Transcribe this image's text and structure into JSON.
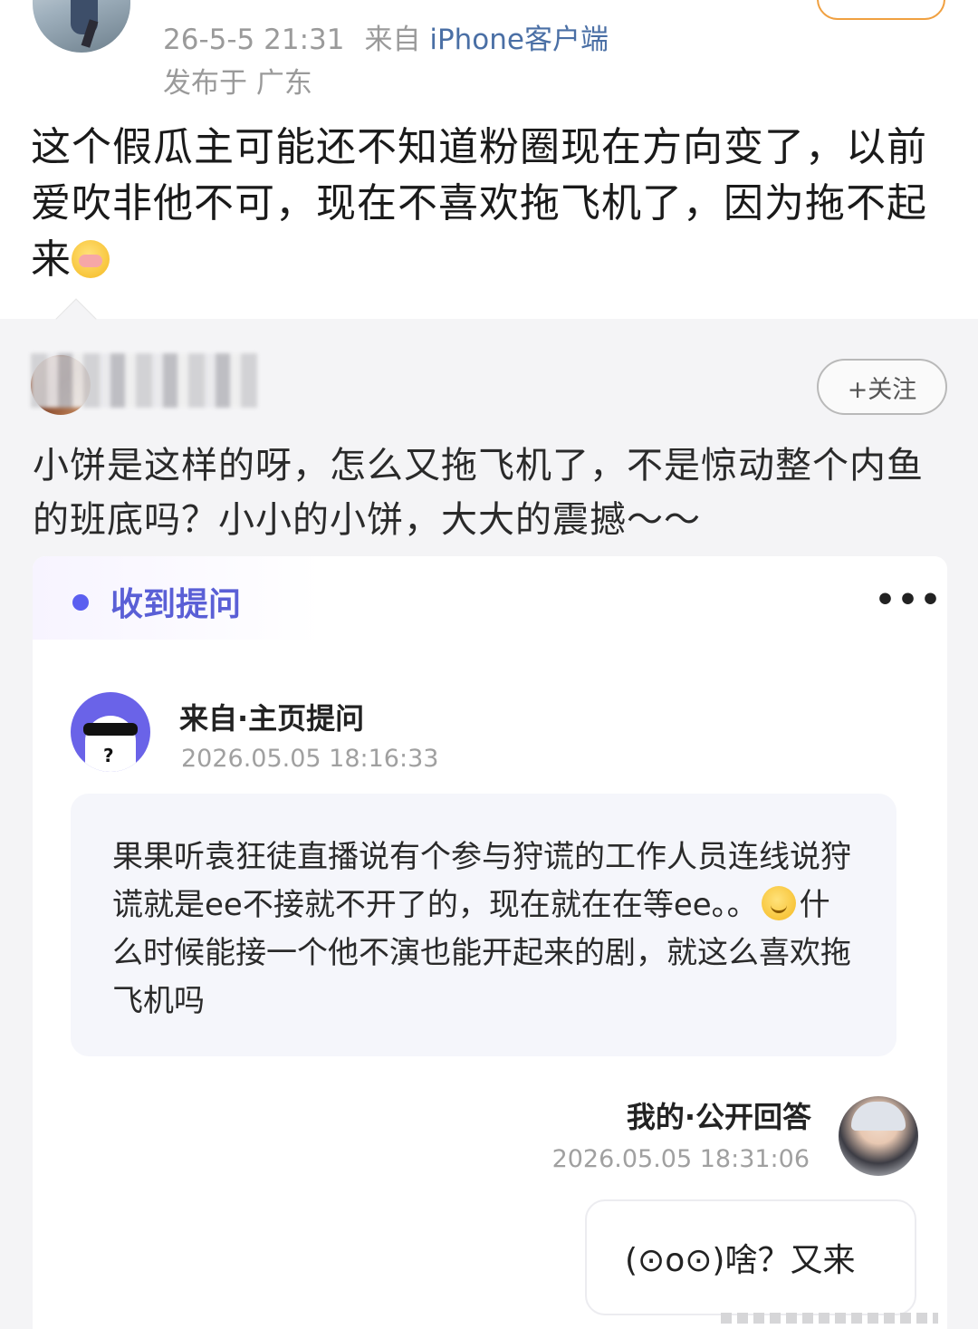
{
  "post": {
    "time": "26-5-5 21:31",
    "source_prefix": "来自",
    "client": "iPhone客户端",
    "location": "发布于 广东",
    "text": "这个假瓜主可能还不知道粉圈现在方向变了，以前爱吹非他不可，现在不喜欢拖飞机了，因为拖不起来",
    "emoji": "cry-emoji"
  },
  "repost": {
    "follow_label": "+关注",
    "text": "小饼是这样的呀，怎么又拖飞机了，不是惊动整个内鱼的班底吗？小小的小饼，大大的震撼～～"
  },
  "card": {
    "title": "收到提问",
    "more": "•••",
    "question": {
      "from_label": "来自·主页提问",
      "time": "2026.05.05 18:16:33",
      "text_before": "果果听袁狂徒直播说有个参与狩谎的工作人员连线说狩谎就是ee不接就不开了的，现在就在在等ee。。",
      "text_after": "什么时候能接一个他不演也能开起来的剧，就这么喜欢拖飞机吗"
    },
    "answer": {
      "label": "我的·公开回答",
      "time": "2026.05.05 18:31:06",
      "text": "(⊙o⊙)啥？又来"
    }
  },
  "colors": {
    "accent_purple": "#5a5fd6",
    "client_blue": "#4a6fa5",
    "follow_orange": "#f0a040"
  }
}
